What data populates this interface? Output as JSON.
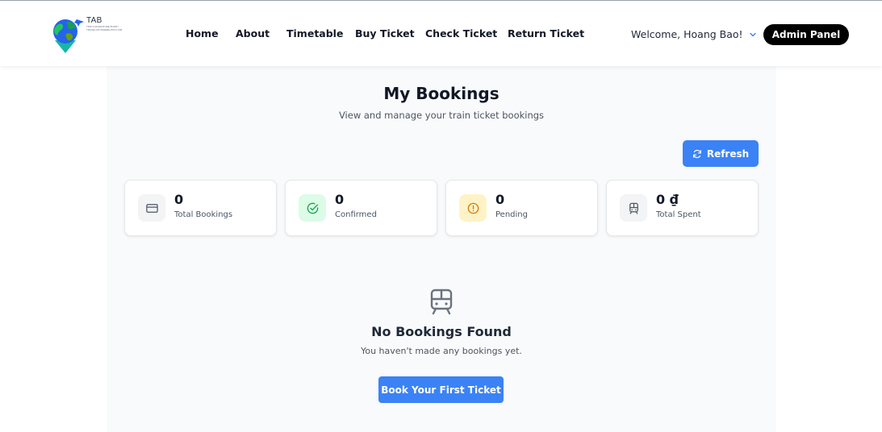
{
  "brand": {
    "name": "TAB",
    "tagline_1": "TRIP & ADVENTURE BUDDY",
    "tagline_2": "TRAVEL ANYWHERE WITH TAB"
  },
  "nav": {
    "items": [
      {
        "label": "Home"
      },
      {
        "label": "About"
      },
      {
        "label": "Timetable"
      },
      {
        "label": "Buy Ticket"
      },
      {
        "label": "Check Ticket"
      },
      {
        "label": "Return Ticket"
      }
    ]
  },
  "user": {
    "welcome": "Welcome, Hoang Bao!"
  },
  "header": {
    "admin_label": "Admin Panel"
  },
  "page": {
    "title": "My Bookings",
    "subtitle": "View and manage your train ticket bookings",
    "refresh_label": "Refresh"
  },
  "stats": [
    {
      "value": "0",
      "label": "Total Bookings",
      "icon": "credit-card-icon"
    },
    {
      "value": "0",
      "label": "Confirmed",
      "icon": "check-circle-icon"
    },
    {
      "value": "0",
      "label": "Pending",
      "icon": "alert-circle-icon"
    },
    {
      "value": "0 ₫",
      "label": "Total Spent",
      "icon": "train-icon"
    }
  ],
  "empty": {
    "title": "No Bookings Found",
    "subtitle": "You haven't made any bookings yet.",
    "cta_label": "Book Your First Ticket",
    "icon": "train-icon"
  },
  "colors": {
    "primary": "#3b82f6",
    "admin_bg": "#000000",
    "confirmed_bg": "#dcfce7",
    "confirmed_fg": "#16a34a",
    "pending_bg": "#fef3c7",
    "pending_fg": "#d97706",
    "neutral_bg": "#f3f4f6",
    "neutral_fg": "#4b5563"
  }
}
